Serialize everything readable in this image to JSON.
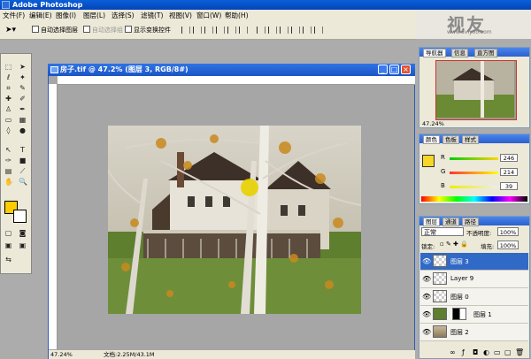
{
  "app": {
    "title": "Adobe Photoshop"
  },
  "menu": [
    "文件(F)",
    "编辑(E)",
    "图像(I)",
    "图层(L)",
    "选择(S)",
    "滤镜(T)",
    "视图(V)",
    "窗口(W)",
    "帮助(H)"
  ],
  "options": {
    "auto_select_layer": "自动选择图层",
    "auto_select_group": "自动选择组",
    "show_transform_controls": "显示变换控件"
  },
  "watermark": {
    "text": "视友",
    "sub": "www.5viyoo.com"
  },
  "document": {
    "title": "房子.tif @ 47.2% (图层 3, RGB/8#)",
    "zoom": "47.24%",
    "doc_info": "文档:2.25M/43.1M"
  },
  "navigator": {
    "tabs": [
      "导航器",
      "信息",
      "直方图"
    ],
    "zoom": "47.24%"
  },
  "color_panel": {
    "tabs": [
      "颜色",
      "色板",
      "样式"
    ],
    "channels": [
      {
        "label": "R",
        "value": "246",
        "level": 0.96
      },
      {
        "label": "G",
        "value": "214",
        "level": 0.84
      },
      {
        "label": "B",
        "value": "39",
        "level": 0.15
      }
    ],
    "foreground": "#f6d627"
  },
  "layers_panel": {
    "tabs": [
      "图层",
      "通道",
      "路径"
    ],
    "blend_mode": "正常",
    "opacity_label": "不透明度:",
    "opacity_value": "100%",
    "lock_label": "锁定:",
    "fill_label": "填充:",
    "fill_value": "100%",
    "layers": [
      {
        "name": "图层 3",
        "selected": true
      },
      {
        "name": "Layer 9",
        "selected": false
      },
      {
        "name": "图层 0",
        "selected": false
      },
      {
        "name": "图层 1",
        "selected": false
      },
      {
        "name": "图层 2",
        "selected": false
      }
    ]
  },
  "colors": {
    "accent": "#3169c6",
    "foreground_swatch": "#ffcc00"
  }
}
